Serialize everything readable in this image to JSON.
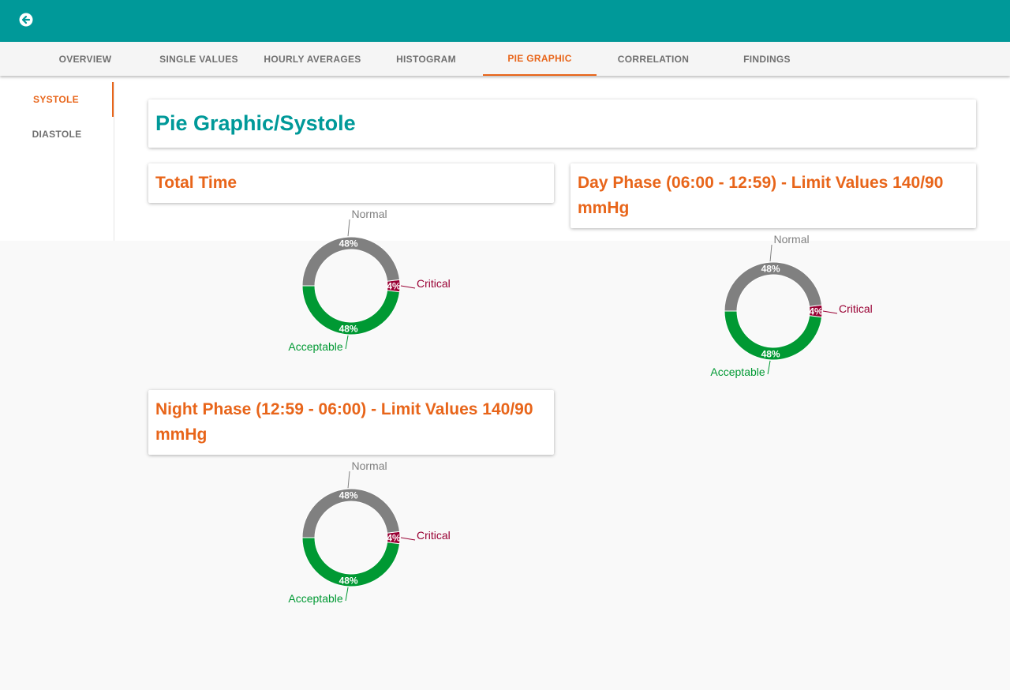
{
  "header": {
    "back_icon": "arrow-left-circle-icon",
    "bar_color": "#009999"
  },
  "tabs": [
    {
      "label": "OVERVIEW"
    },
    {
      "label": "SINGLE VALUES"
    },
    {
      "label": "HOURLY AVERAGES"
    },
    {
      "label": "HISTOGRAM"
    },
    {
      "label": "PIE GRAPHIC",
      "active": true
    },
    {
      "label": "CORRELATION"
    },
    {
      "label": "FINDINGS"
    }
  ],
  "sidebar": {
    "items": [
      {
        "label": "SYSTOLE",
        "active": true
      },
      {
        "label": "DIASTOLE"
      }
    ]
  },
  "page": {
    "title": "Pie Graphic/Systole"
  },
  "colors": {
    "accent": "#e8651a",
    "primary": "#009999",
    "normal": "#808080",
    "acceptable": "#009933",
    "critical": "#990033"
  },
  "chart_data": [
    {
      "type": "pie",
      "title": "Total Time",
      "donut": true,
      "slices": [
        {
          "label": "Normal",
          "value": 48,
          "display": "48%",
          "color": "#808080"
        },
        {
          "label": "Critical",
          "value": 4,
          "display": "4%",
          "color": "#990033"
        },
        {
          "label": "Acceptable",
          "value": 48,
          "display": "48%",
          "color": "#009933"
        }
      ]
    },
    {
      "type": "pie",
      "title": "Day Phase (06:00 - 12:59) - Limit Values 140/90 mmHg",
      "donut": true,
      "slices": [
        {
          "label": "Normal",
          "value": 48,
          "display": "48%",
          "color": "#808080"
        },
        {
          "label": "Critical",
          "value": 4,
          "display": "4%",
          "color": "#990033"
        },
        {
          "label": "Acceptable",
          "value": 48,
          "display": "48%",
          "color": "#009933"
        }
      ]
    },
    {
      "type": "pie",
      "title": "Night Phase (12:59 - 06:00) - Limit Values 140/90 mmHg",
      "donut": true,
      "slices": [
        {
          "label": "Normal",
          "value": 48,
          "display": "48%",
          "color": "#808080"
        },
        {
          "label": "Critical",
          "value": 4,
          "display": "4%",
          "color": "#990033"
        },
        {
          "label": "Acceptable",
          "value": 48,
          "display": "48%",
          "color": "#009933"
        }
      ]
    }
  ]
}
